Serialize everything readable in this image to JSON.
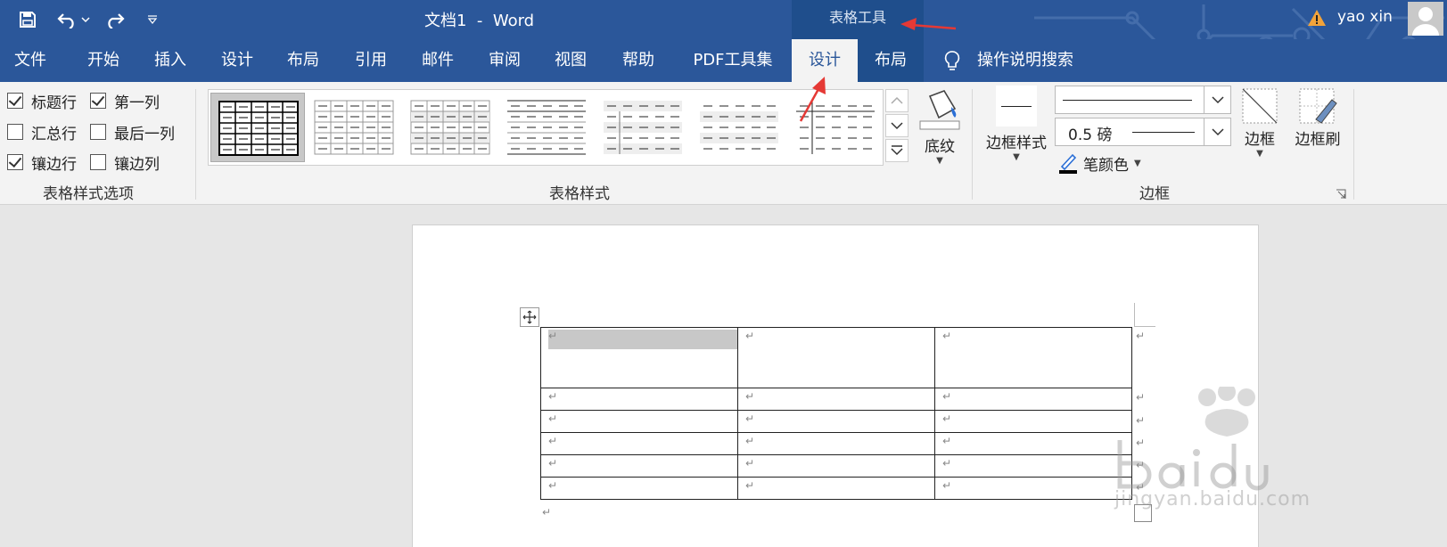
{
  "titlebar": {
    "doc_title": "文档1  -  Word",
    "context_header": "表格工具",
    "user_name": "yao xin"
  },
  "tabs": [
    {
      "label": "文件"
    },
    {
      "label": "开始"
    },
    {
      "label": "插入"
    },
    {
      "label": "设计"
    },
    {
      "label": "布局"
    },
    {
      "label": "引用"
    },
    {
      "label": "邮件"
    },
    {
      "label": "审阅"
    },
    {
      "label": "视图"
    },
    {
      "label": "帮助"
    },
    {
      "label": "PDF工具集"
    },
    {
      "label": "设计",
      "active": true
    },
    {
      "label": "布局"
    }
  ],
  "search": {
    "label": "操作说明搜索"
  },
  "ribbon": {
    "style_options": {
      "label": "表格样式选项",
      "options": [
        {
          "label": "标题行",
          "checked": true
        },
        {
          "label": "第一列",
          "checked": true
        },
        {
          "label": "汇总行",
          "checked": false
        },
        {
          "label": "最后一列",
          "checked": false
        },
        {
          "label": "镶边行",
          "checked": true
        },
        {
          "label": "镶边列",
          "checked": false
        }
      ]
    },
    "table_styles": {
      "label": "表格样式",
      "shading_label": "底纹"
    },
    "borders": {
      "label": "边框",
      "border_styles_label": "边框样式",
      "weight_value": "0.5 磅",
      "pen_color_label": "笔颜色",
      "borders_label": "边框",
      "painter_label": "边框刷"
    }
  },
  "document": {
    "cell_mark": "↵"
  },
  "watermark": {
    "text": "jingyan.baidu.com",
    "brand": "Bai du 经验"
  },
  "colors": {
    "accent": "#2b579a",
    "context": "#1f4e8c",
    "arrow": "#e53935"
  }
}
